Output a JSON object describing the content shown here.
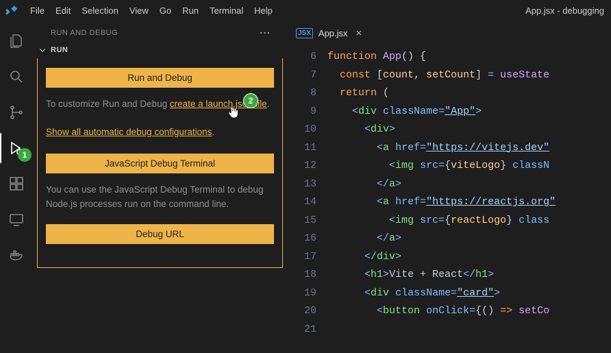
{
  "titlebar": {
    "menus": [
      "File",
      "Edit",
      "Selection",
      "View",
      "Go",
      "Run",
      "Terminal",
      "Help"
    ],
    "winTitle": "App.jsx - debugging"
  },
  "activityBadges": {
    "debug": "1"
  },
  "annotations": {
    "createLaunch": "2"
  },
  "sidepanel": {
    "title": "RUN AND DEBUG",
    "section": "RUN",
    "runBtn": "Run and Debug",
    "customizePrefix": "To customize Run and Debug ",
    "createLaunchLink": "create a launch.json file",
    "period": ".",
    "showAllLink": "Show all automatic debug configurations",
    "jsTerminalBtn": "JavaScript Debug Terminal",
    "jsTermHelp": "You can use the JavaScript Debug Terminal to debug Node.js processes run on the command line.",
    "debugUrlBtn": "Debug URL"
  },
  "tab": {
    "label": "App.jsx"
  },
  "code": {
    "startLine": 6,
    "lines": [
      [
        [
          "kw",
          "function"
        ],
        [
          "pn",
          " "
        ],
        [
          "fn",
          "App"
        ],
        [
          "pn",
          "() {"
        ]
      ],
      [
        [
          "pn",
          "  "
        ],
        [
          "kw",
          "const"
        ],
        [
          "pn",
          " ["
        ],
        [
          "id",
          "count"
        ],
        [
          "pn",
          ", "
        ],
        [
          "id",
          "setCount"
        ],
        [
          "pn",
          "] "
        ],
        [
          "op",
          "="
        ],
        [
          "pn",
          " "
        ],
        [
          "fn",
          "useState"
        ]
      ],
      [
        [
          "pn",
          ""
        ]
      ],
      [
        [
          "pn",
          "  "
        ],
        [
          "kw",
          "return"
        ],
        [
          "pn",
          " ("
        ]
      ],
      [
        [
          "pn",
          "    "
        ],
        [
          "op",
          "<"
        ],
        [
          "tag",
          "div"
        ],
        [
          "pn",
          " "
        ],
        [
          "attr",
          "className"
        ],
        [
          "op",
          "="
        ],
        [
          "str",
          "\"App\""
        ],
        [
          "op",
          ">"
        ]
      ],
      [
        [
          "pn",
          "      "
        ],
        [
          "op",
          "<"
        ],
        [
          "tag",
          "div"
        ],
        [
          "op",
          ">"
        ]
      ],
      [
        [
          "pn",
          "        "
        ],
        [
          "op",
          "<"
        ],
        [
          "tag",
          "a"
        ],
        [
          "pn",
          " "
        ],
        [
          "attr",
          "href"
        ],
        [
          "op",
          "="
        ],
        [
          "str",
          "\"https://vitejs.dev\""
        ]
      ],
      [
        [
          "pn",
          "          "
        ],
        [
          "op",
          "<"
        ],
        [
          "tag",
          "img"
        ],
        [
          "pn",
          " "
        ],
        [
          "attr",
          "src"
        ],
        [
          "op",
          "="
        ],
        [
          "pn",
          "{"
        ],
        [
          "id",
          "viteLogo"
        ],
        [
          "pn",
          "} "
        ],
        [
          "attr",
          "classN"
        ]
      ],
      [
        [
          "pn",
          "        "
        ],
        [
          "op",
          "</"
        ],
        [
          "tag",
          "a"
        ],
        [
          "op",
          ">"
        ]
      ],
      [
        [
          "pn",
          "        "
        ],
        [
          "op",
          "<"
        ],
        [
          "tag",
          "a"
        ],
        [
          "pn",
          " "
        ],
        [
          "attr",
          "href"
        ],
        [
          "op",
          "="
        ],
        [
          "str",
          "\"https://reactjs.org\""
        ]
      ],
      [
        [
          "pn",
          "          "
        ],
        [
          "op",
          "<"
        ],
        [
          "tag",
          "img"
        ],
        [
          "pn",
          " "
        ],
        [
          "attr",
          "src"
        ],
        [
          "op",
          "="
        ],
        [
          "pn",
          "{"
        ],
        [
          "id",
          "reactLogo"
        ],
        [
          "pn",
          "} "
        ],
        [
          "attr",
          "class"
        ]
      ],
      [
        [
          "pn",
          "        "
        ],
        [
          "op",
          "</"
        ],
        [
          "tag",
          "a"
        ],
        [
          "op",
          ">"
        ]
      ],
      [
        [
          "pn",
          "      "
        ],
        [
          "op",
          "</"
        ],
        [
          "tag",
          "div"
        ],
        [
          "op",
          ">"
        ]
      ],
      [
        [
          "pn",
          "      "
        ],
        [
          "op",
          "<"
        ],
        [
          "tag",
          "h1"
        ],
        [
          "op",
          ">"
        ],
        [
          "txt",
          "Vite + React"
        ],
        [
          "op",
          "</"
        ],
        [
          "tag",
          "h1"
        ],
        [
          "op",
          ">"
        ]
      ],
      [
        [
          "pn",
          "      "
        ],
        [
          "op",
          "<"
        ],
        [
          "tag",
          "div"
        ],
        [
          "pn",
          " "
        ],
        [
          "attr",
          "className"
        ],
        [
          "op",
          "="
        ],
        [
          "str",
          "\"card\""
        ],
        [
          "op",
          ">"
        ]
      ],
      [
        [
          "pn",
          "        "
        ],
        [
          "op",
          "<"
        ],
        [
          "tag",
          "button"
        ],
        [
          "pn",
          " "
        ],
        [
          "attr",
          "onClick"
        ],
        [
          "op",
          "="
        ],
        [
          "pn",
          "{() "
        ],
        [
          "kw",
          "=>"
        ],
        [
          "pn",
          " "
        ],
        [
          "fn",
          "setCo"
        ]
      ]
    ]
  }
}
